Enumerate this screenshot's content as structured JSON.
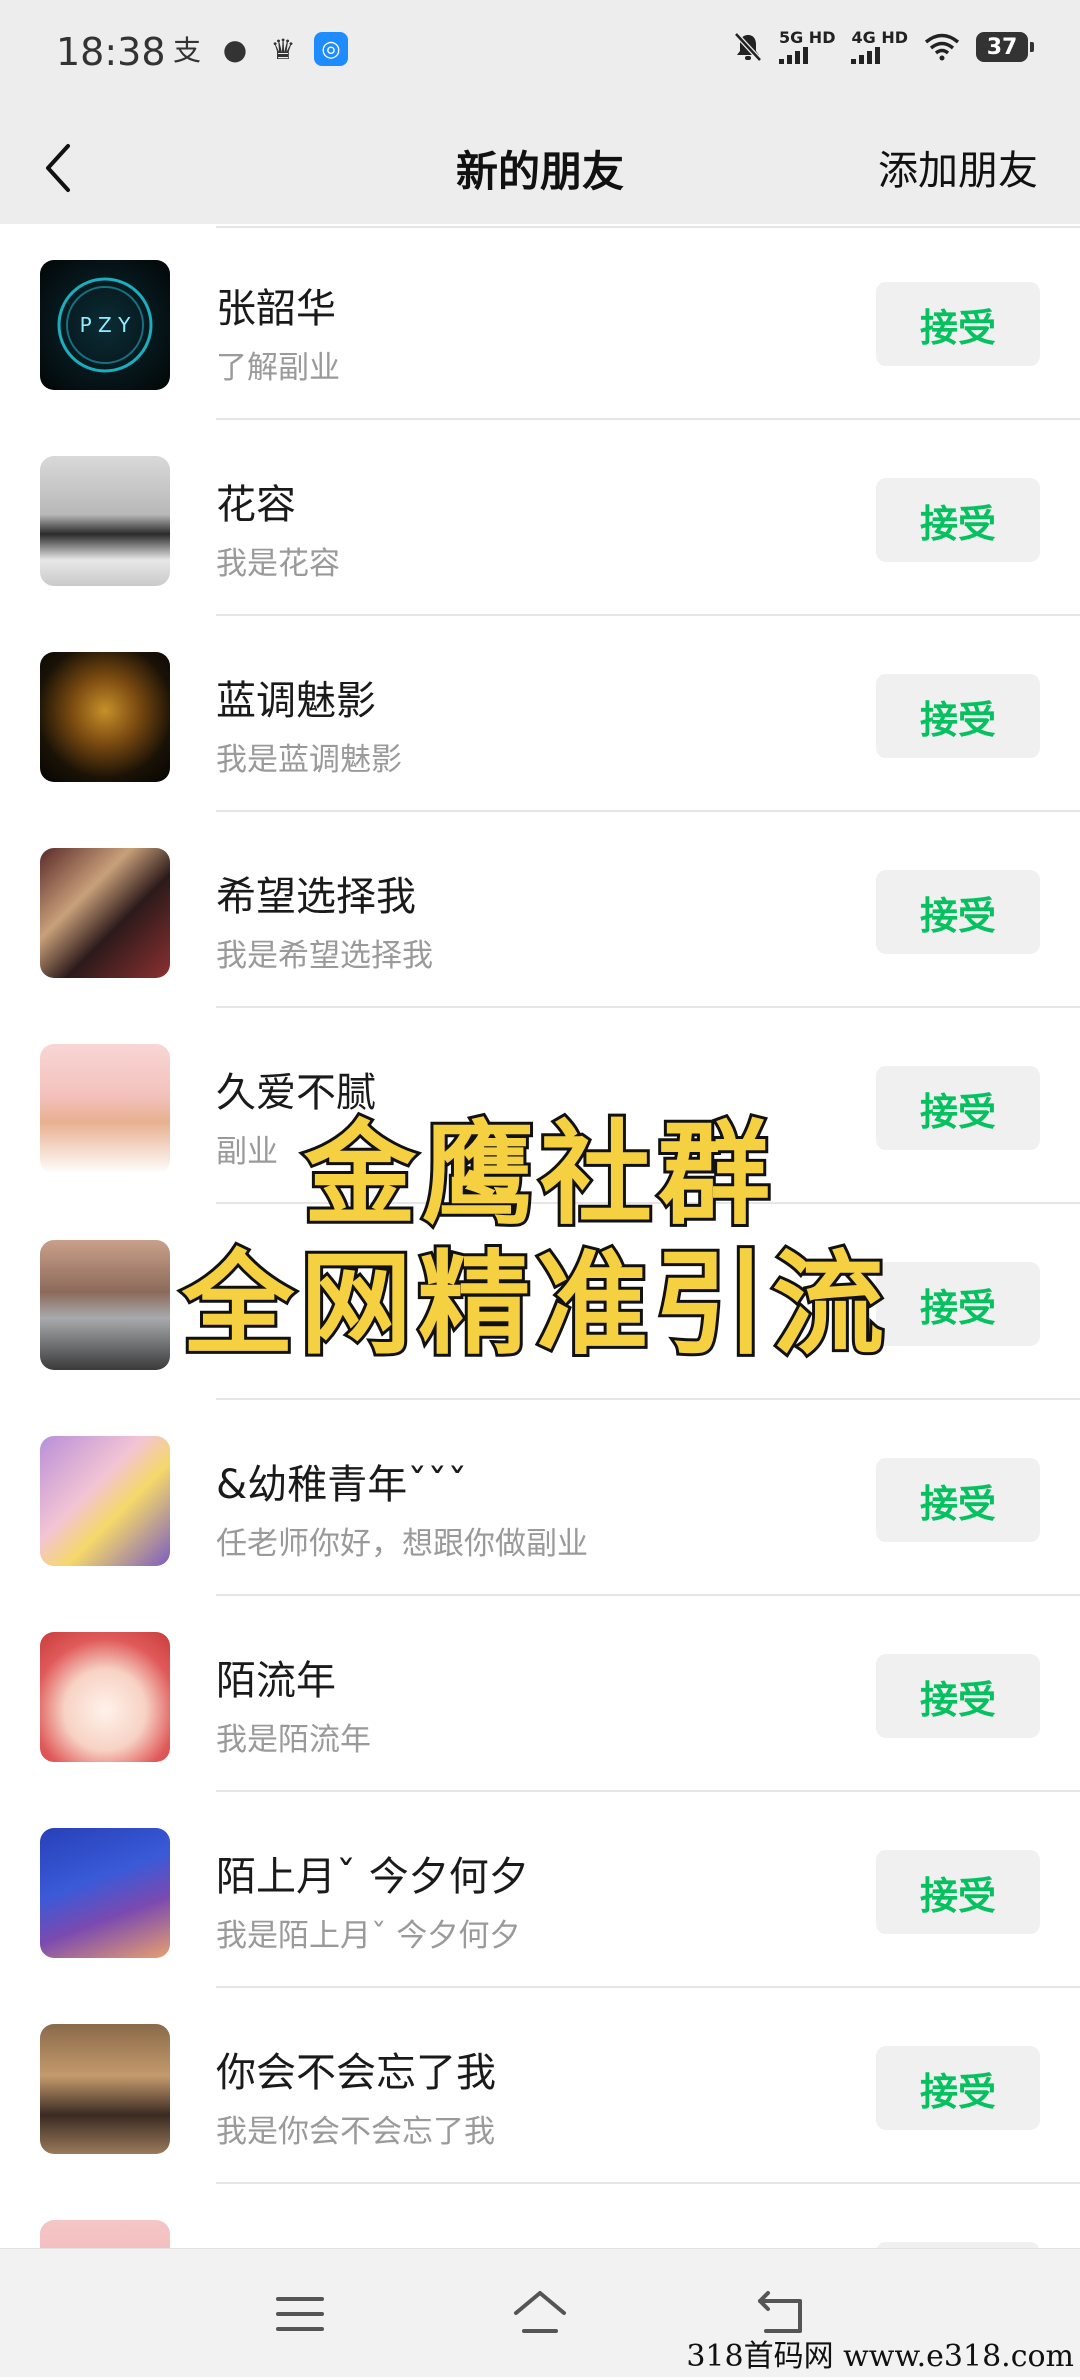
{
  "status": {
    "time": "18:38",
    "left_icons": [
      "alipay-icon",
      "wechat-icon",
      "crown-icon",
      "app-icon"
    ],
    "sim1": "5G HD",
    "sim2": "4G HD",
    "battery": "37"
  },
  "nav": {
    "title": "新的朋友",
    "add_label": "添加朋友"
  },
  "accept_label": "接受",
  "requests": [
    {
      "name": "张韶华",
      "message": "了解副业"
    },
    {
      "name": "花容",
      "message": "我是花容"
    },
    {
      "name": "蓝调魅影",
      "message": "我是蓝调魅影"
    },
    {
      "name": "希望选择我",
      "message": "我是希望选择我"
    },
    {
      "name": "久爱不腻",
      "message": "副业"
    },
    {
      "name": "",
      "message": ""
    },
    {
      "name": "&幼稚青年ˇˇˇ",
      "message": "任老师你好，想跟你做副业"
    },
    {
      "name": "陌流年",
      "message": "我是陌流年"
    },
    {
      "name": "陌上月ˇ 今夕何夕",
      "message": "我是陌上月ˇ 今夕何夕"
    },
    {
      "name": "你会不会忘了我",
      "message": "我是你会不会忘了我"
    },
    {
      "name": "",
      "message": ""
    }
  ],
  "overlay": {
    "line1": "金鹰社群",
    "line2": "全网精准引流"
  },
  "watermark": "318首码网  www.e318.com"
}
